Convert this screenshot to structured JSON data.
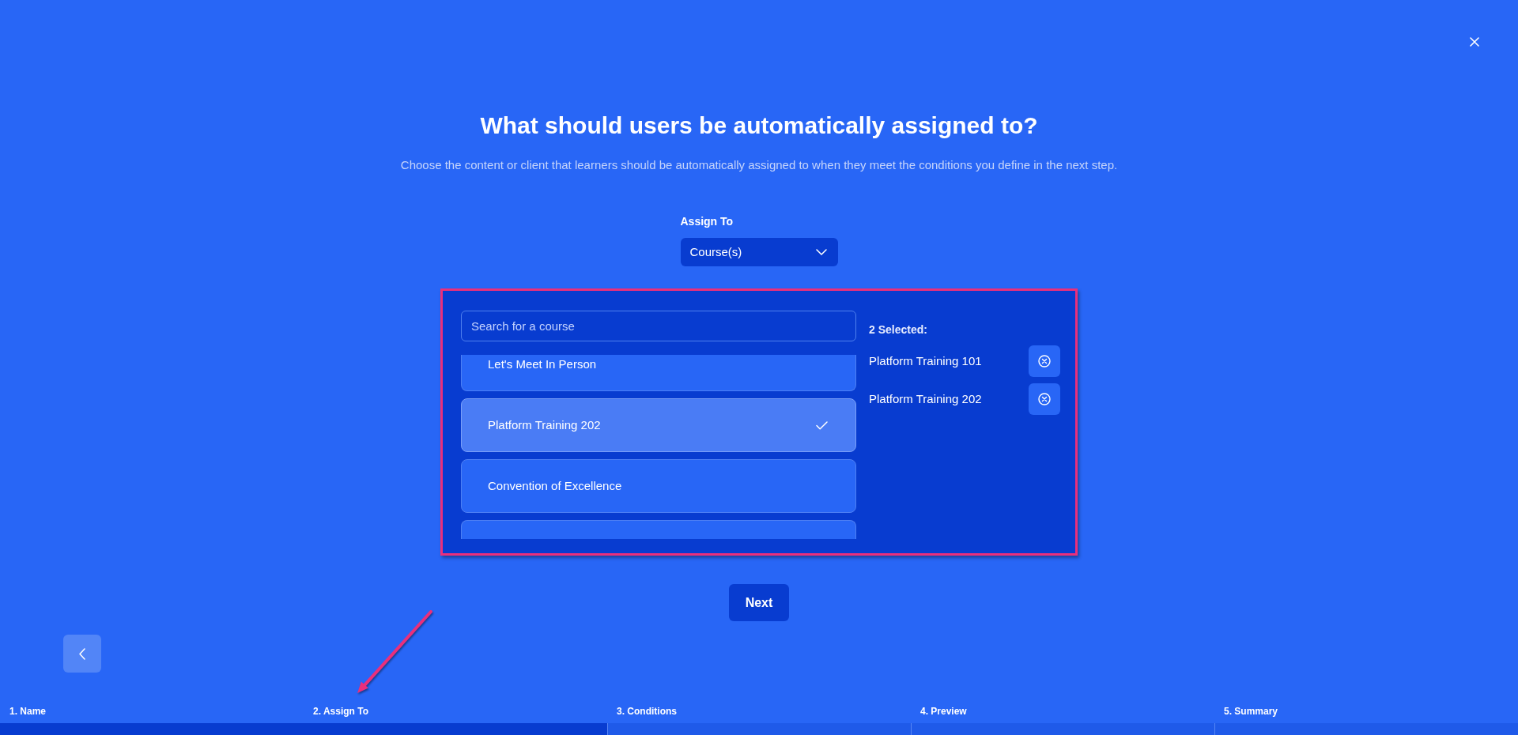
{
  "heading": {
    "title": "What should users be automatically assigned to?",
    "subtitle": "Choose the content or client that learners should be automatically assigned to when they meet the conditions you define in the next step."
  },
  "assign_to": {
    "label": "Assign To",
    "value": "Course(s)"
  },
  "course_picker": {
    "search": {
      "placeholder": "Search for a course"
    },
    "courses": [
      {
        "name": "Let's Meet In Person",
        "selected": false
      },
      {
        "name": "Platform Training 202",
        "selected": true
      },
      {
        "name": "Convention of Excellence",
        "selected": false
      }
    ],
    "selected_heading": "2 Selected:",
    "selected_items": [
      {
        "name": "Platform Training 101"
      },
      {
        "name": "Platform Training 202"
      }
    ]
  },
  "next_button": {
    "label": "Next"
  },
  "steps": [
    {
      "label": "1. Name",
      "completed": true
    },
    {
      "label": "2. Assign To",
      "completed": true
    },
    {
      "label": "3. Conditions",
      "completed": false
    },
    {
      "label": "4. Preview",
      "completed": false
    },
    {
      "label": "5. Summary",
      "completed": false
    }
  ]
}
